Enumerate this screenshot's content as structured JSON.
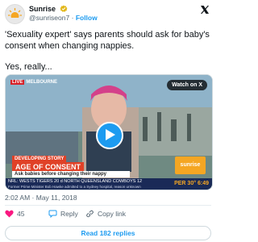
{
  "author": {
    "name": "Sunrise",
    "handle": "@sunriseon7",
    "separator": "·",
    "follow_label": "Follow"
  },
  "tweet": {
    "line1": "'Sexuality expert' says parents should ask for baby's consent when changing nappies.",
    "line2": "Yes, really..."
  },
  "media": {
    "live_tag": "LIVE",
    "location": "MELBOURNE",
    "watch_label": "Watch on X",
    "story_tag": "DEVELOPING STORY",
    "headline": "AGE OF CONSENT",
    "subline": "Ask babies before changing their nappy",
    "logo_text": "sunrise",
    "ticker_main": "NRL: WESTS TIGERS 20 d NORTH QUEENSLAND COWBOYS 12",
    "ticker_sub": "Former Prime Minister Bob Hawke admitted to a Sydney hospital, reason unknown",
    "ticker_temp": "PER 30°",
    "ticker_time": "6:49"
  },
  "meta": {
    "timestamp": "2:02 AM · May 11, 2018"
  },
  "actions": {
    "likes": "45",
    "reply_label": "Reply",
    "copy_label": "Copy link"
  },
  "replies_button": "Read 182 replies",
  "colors": {
    "accent": "#1d9bf0",
    "like": "#f91880",
    "headline_bg": "#e04127",
    "ticker_bg": "#1a2a57"
  },
  "icons": [
    "sunrise-avatar-icon",
    "verified-badge-icon",
    "x-logo-icon",
    "play-icon",
    "heart-icon",
    "reply-icon",
    "link-icon"
  ]
}
